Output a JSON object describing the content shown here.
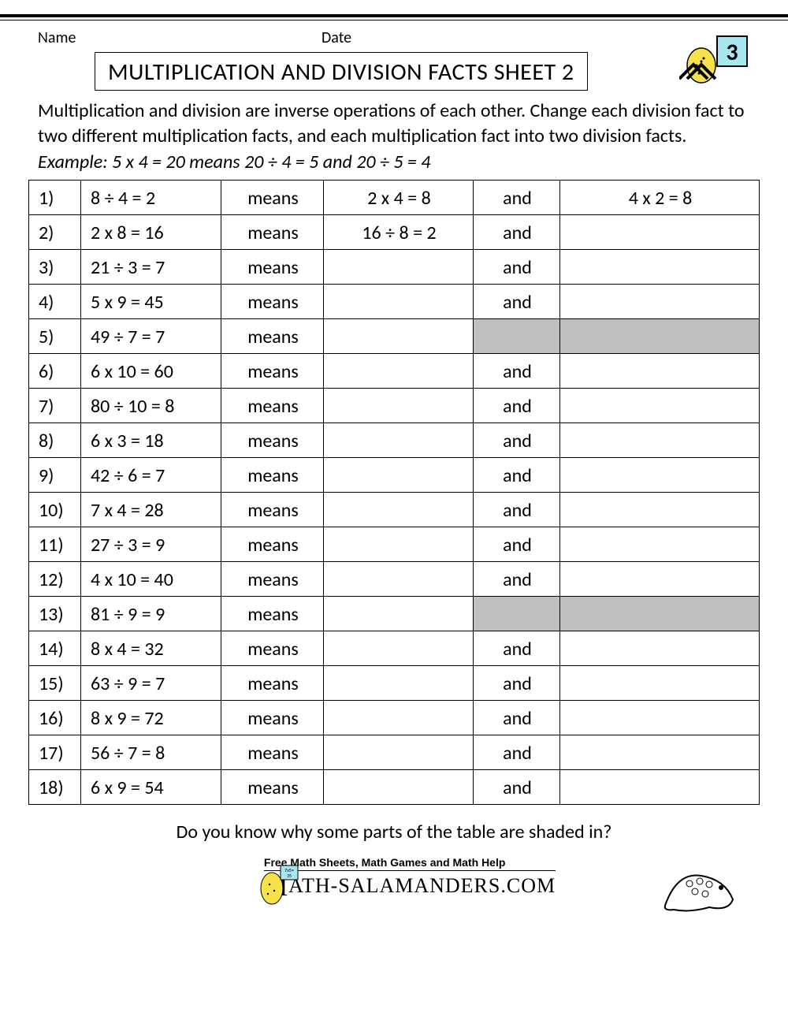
{
  "meta": {
    "name_label": "Name",
    "date_label": "Date"
  },
  "title": "MULTIPLICATION AND DIVISION FACTS SHEET 2",
  "badge_grade": "3",
  "instructions": {
    "text": "Multiplication and division are inverse operations of each other. Change each division fact to two different multiplication facts, and each multiplication fact into two division facts. ",
    "example": "Example: 5 x 4 = 20 means 20 ÷ 4 = 5 and 20 ÷ 5 = 4"
  },
  "means_label": "means",
  "and_label": "and",
  "rows": [
    {
      "n": "1)",
      "fact": "8 ÷ 4 = 2",
      "a1": "2 x 4 = 8",
      "and": "and",
      "a2": "4 x 2 = 8",
      "s1": false,
      "s2": false
    },
    {
      "n": "2)",
      "fact": "2 x 8 = 16",
      "a1": "16 ÷ 8 = 2",
      "and": "and",
      "a2": "",
      "s1": false,
      "s2": false
    },
    {
      "n": "3)",
      "fact": "21 ÷ 3 = 7",
      "a1": "",
      "and": "and",
      "a2": "",
      "s1": false,
      "s2": false
    },
    {
      "n": "4)",
      "fact": "5 x 9 = 45",
      "a1": "",
      "and": "and",
      "a2": "",
      "s1": false,
      "s2": false
    },
    {
      "n": "5)",
      "fact": "49 ÷ 7 = 7",
      "a1": "",
      "and": "",
      "a2": "",
      "s1": true,
      "s2": true
    },
    {
      "n": "6)",
      "fact": "6 x 10 = 60",
      "a1": "",
      "and": "and",
      "a2": "",
      "s1": false,
      "s2": false
    },
    {
      "n": "7)",
      "fact": "80 ÷ 10 = 8",
      "a1": "",
      "and": "and",
      "a2": "",
      "s1": false,
      "s2": false
    },
    {
      "n": "8)",
      "fact": "6 x 3 = 18",
      "a1": "",
      "and": "and",
      "a2": "",
      "s1": false,
      "s2": false
    },
    {
      "n": "9)",
      "fact": "42 ÷ 6 = 7",
      "a1": "",
      "and": "and",
      "a2": "",
      "s1": false,
      "s2": false
    },
    {
      "n": "10)",
      "fact": "7 x 4 = 28",
      "a1": "",
      "and": "and",
      "a2": "",
      "s1": false,
      "s2": false
    },
    {
      "n": "11)",
      "fact": "27 ÷ 3 = 9",
      "a1": "",
      "and": "and",
      "a2": "",
      "s1": false,
      "s2": false
    },
    {
      "n": "12)",
      "fact": "4 x 10 = 40",
      "a1": "",
      "and": "and",
      "a2": "",
      "s1": false,
      "s2": false
    },
    {
      "n": "13)",
      "fact": "81 ÷ 9 = 9",
      "a1": "",
      "and": "",
      "a2": "",
      "s1": true,
      "s2": true
    },
    {
      "n": "14)",
      "fact": "8 x 4 = 32",
      "a1": "",
      "and": "and",
      "a2": "",
      "s1": false,
      "s2": false
    },
    {
      "n": "15)",
      "fact": "63 ÷ 9 = 7",
      "a1": "",
      "and": "and",
      "a2": "",
      "s1": false,
      "s2": false
    },
    {
      "n": "16)",
      "fact": "8 x 9 = 72",
      "a1": "",
      "and": "and",
      "a2": "",
      "s1": false,
      "s2": false
    },
    {
      "n": "17)",
      "fact": "56 ÷ 7 = 8",
      "a1": "",
      "and": "and",
      "a2": "",
      "s1": false,
      "s2": false
    },
    {
      "n": "18)",
      "fact": "6 x 9 = 54",
      "a1": "",
      "and": "and",
      "a2": "",
      "s1": false,
      "s2": false
    }
  ],
  "bottom_question": "Do you know why some parts of the table are shaded in?",
  "footer": {
    "tagline": "Free Math Sheets, Math Games and Math Help",
    "brand": "ATH-SALAMANDERS.COM"
  }
}
